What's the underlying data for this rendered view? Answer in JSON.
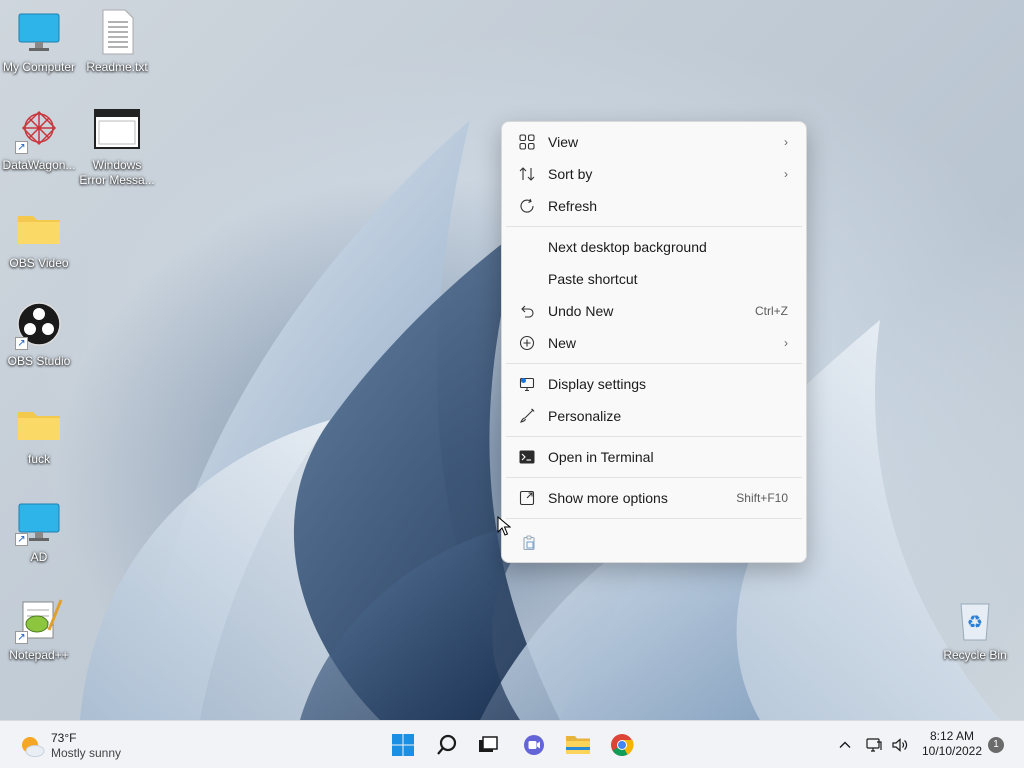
{
  "desktop": {
    "icons": [
      {
        "label": "My Computer",
        "type": "monitor"
      },
      {
        "label": "Readme.txt",
        "type": "document"
      },
      {
        "label": "DataWagon...",
        "type": "app"
      },
      {
        "label": "Windows\nError Messa...",
        "type": "window"
      },
      {
        "label": "OBS Video",
        "type": "folder"
      },
      {
        "label": "OBS Studio",
        "type": "obs"
      },
      {
        "label": "fuck",
        "type": "folder"
      },
      {
        "label": "AD",
        "type": "monitor"
      },
      {
        "label": "Notepad++",
        "type": "notepad"
      },
      {
        "label": "Recycle Bin",
        "type": "recycle"
      }
    ]
  },
  "context_menu": {
    "items": [
      {
        "label": "View",
        "icon": "grid-icon",
        "submenu": true
      },
      {
        "label": "Sort by",
        "icon": "sort-icon",
        "submenu": true
      },
      {
        "label": "Refresh",
        "icon": "refresh-icon"
      },
      {
        "label": "Next desktop background"
      },
      {
        "label": "Paste shortcut"
      },
      {
        "label": "Undo New",
        "icon": "undo-icon",
        "shortcut": "Ctrl+Z"
      },
      {
        "label": "New",
        "icon": "plus-circle-icon",
        "submenu": true
      },
      {
        "label": "Display settings",
        "icon": "display-icon"
      },
      {
        "label": "Personalize",
        "icon": "brush-icon"
      },
      {
        "label": "Open in Terminal",
        "icon": "terminal-icon"
      },
      {
        "label": "Show more options",
        "icon": "expand-icon",
        "shortcut": "Shift+F10"
      }
    ],
    "chevron": "›"
  },
  "taskbar": {
    "weather": {
      "temp": "73°F",
      "condition": "Mostly sunny"
    },
    "clock": {
      "time": "8:12 AM",
      "date": "10/10/2022"
    },
    "notification_count": "1"
  }
}
